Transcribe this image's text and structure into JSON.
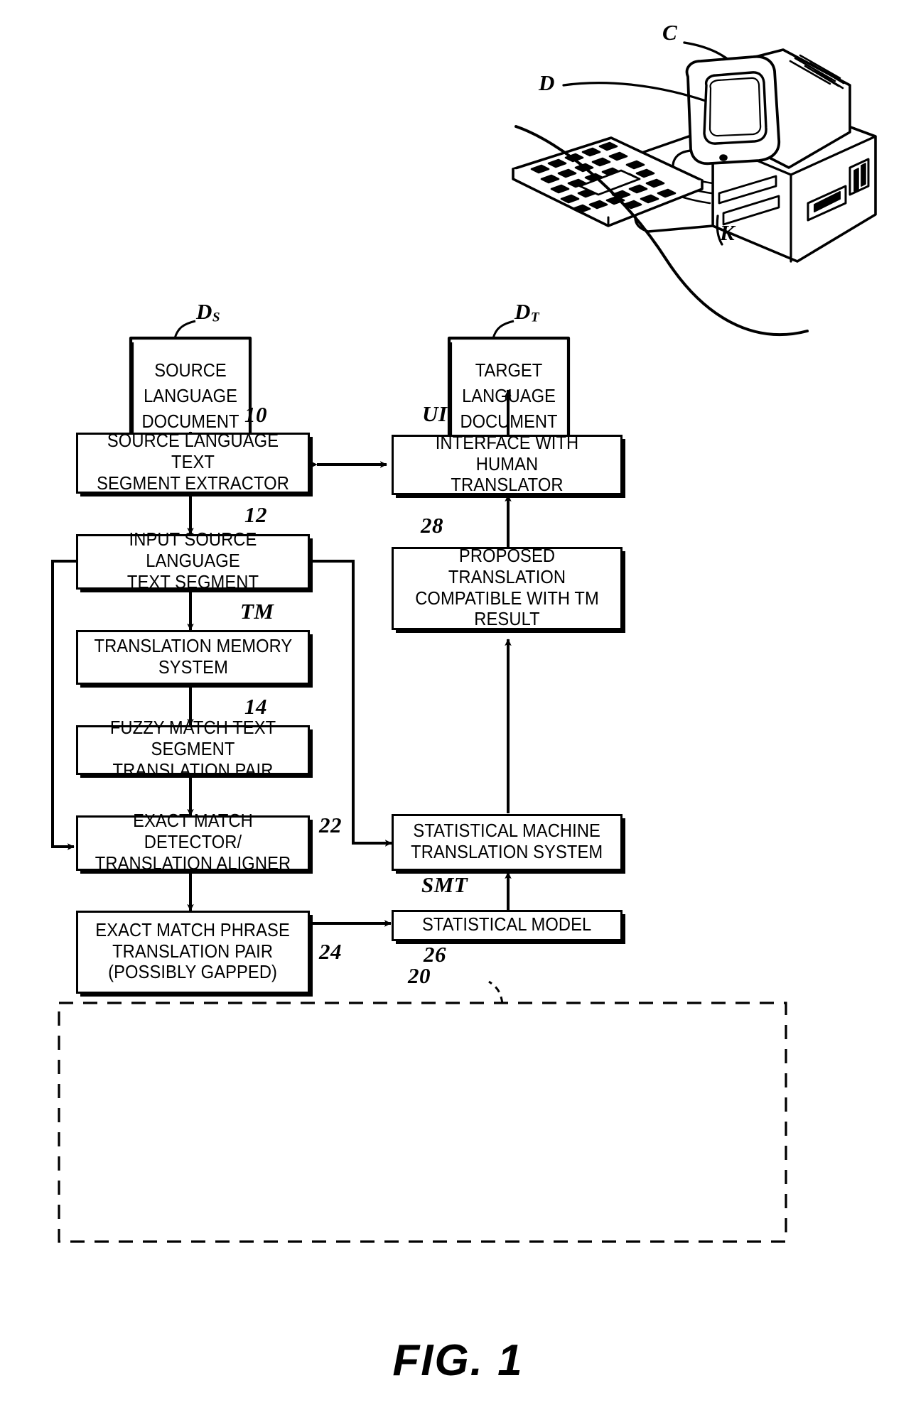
{
  "figure": {
    "caption": "FIG. 1",
    "type": "patent-flow-diagram"
  },
  "documents": [
    {
      "id": "source-document",
      "ref": "D",
      "ref_sub": "S",
      "lines": [
        "SOURCE",
        "LANGUAGE",
        "DOCUMENT"
      ]
    },
    {
      "id": "target-document",
      "ref": "D",
      "ref_sub": "T",
      "lines": [
        "TARGET",
        "LANGUAGE",
        "DOCUMENT"
      ]
    }
  ],
  "hardware": {
    "computer_ref": "C",
    "display_ref": "D",
    "keyboard_ref": "K"
  },
  "boxes": [
    {
      "id": "source-language-text-segment-extractor",
      "ref": "10",
      "lines": [
        "SOURCE LANGUAGE TEXT",
        "SEGMENT EXTRACTOR"
      ]
    },
    {
      "id": "input-source-language-text-segment",
      "ref": "12",
      "lines": [
        "INPUT SOURCE LANGUAGE",
        "TEXT SEGMENT"
      ]
    },
    {
      "id": "translation-memory-system",
      "ref": "TM",
      "lines": [
        "TRANSLATION MEMORY",
        "SYSTEM"
      ]
    },
    {
      "id": "fuzzy-match-text-segment-translation-pair",
      "ref": "14",
      "lines": [
        "FUZZY MATCH TEXT SEGMENT",
        "TRANSLATION PAIR"
      ]
    },
    {
      "id": "exact-match-detector-translation-aligner",
      "ref": "22",
      "lines": [
        "EXACT MATCH DETECTOR/",
        "TRANSLATION ALIGNER"
      ]
    },
    {
      "id": "exact-match-phrase-translation-pair",
      "ref": "24",
      "lines": [
        "EXACT MATCH PHRASE",
        "TRANSLATION PAIR",
        "(POSSIBLY GAPPED)"
      ]
    },
    {
      "id": "interface-with-human-translator",
      "ref": "UI",
      "lines": [
        "INTERFACE WITH HUMAN",
        "TRANSLATOR"
      ]
    },
    {
      "id": "proposed-translation-compatible-with-tm-result",
      "ref": "28",
      "lines": [
        "PROPOSED TRANSLATION",
        "COMPATIBLE WITH TM",
        "RESULT"
      ]
    },
    {
      "id": "statistical-machine-translation-system",
      "ref": "SMT",
      "lines": [
        "STATISTICAL MACHINE",
        "TRANSLATION SYSTEM"
      ]
    },
    {
      "id": "statistical-model",
      "ref": "26",
      "lines": [
        "STATISTICAL MODEL"
      ]
    }
  ],
  "dashed_region": {
    "id": "smt-subsystem-boundary",
    "ref": "20"
  },
  "colors": {
    "ink": "#000000",
    "paper": "#ffffff"
  }
}
